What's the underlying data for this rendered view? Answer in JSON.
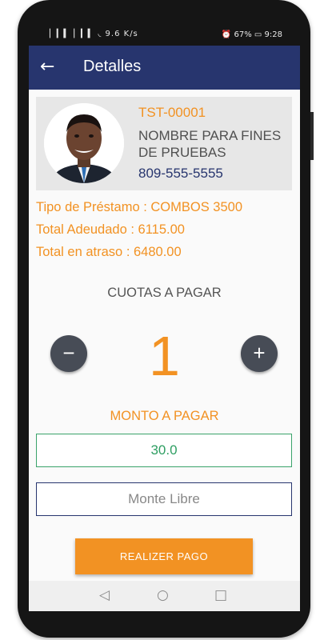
{
  "status_bar": {
    "left": "▏▎▍ ▏▎▍ ◟ 9.6 K/s",
    "right": "⏰ 67% ▭ 9:28"
  },
  "appbar": {
    "title": "Detalles",
    "back_icon": "arrow-back-icon"
  },
  "client": {
    "code": "TST-00001",
    "name": "NOMBRE PARA FINES DE PRUEBAS",
    "phone": "809-555-5555"
  },
  "loan": {
    "type": "Tipo de Préstamo : COMBOS 3500",
    "total_owed": "Total Adeudado : 6115.00",
    "total_overdue": "Total en atraso : 6480.00"
  },
  "cuotas": {
    "label": "CUOTAS A PAGAR",
    "minus": "−",
    "plus": "+",
    "value": "1"
  },
  "monto": {
    "label": "MONTO A PAGAR",
    "value": "30.0",
    "free_placeholder": "Monte Libre"
  },
  "pay_button": "REALIZER PAGO",
  "nav": {
    "back": "◁",
    "home": "○",
    "recents": "□"
  },
  "colors": {
    "primary": "#27356e",
    "accent": "#f29223",
    "success": "#2e9e62"
  }
}
